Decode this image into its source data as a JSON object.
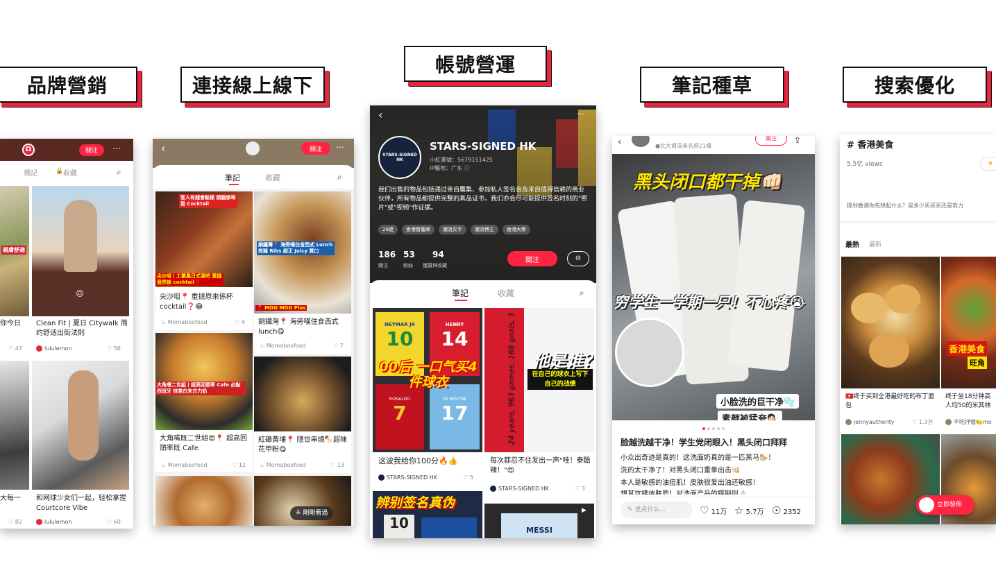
{
  "section_labels": [
    "品牌營銷",
    "連接線上線下",
    "帳號營運",
    "筆記種草",
    "搜索優化"
  ],
  "phone1": {
    "follow": "關注",
    "tabs": [
      "標記",
      "收藏"
    ],
    "cards": [
      {
        "title": "你今日",
        "likes": "47"
      },
      {
        "title": "Clean Fit | 夏日 Citywalk 简约舒适出街法則",
        "author": "lululemon",
        "likes": "56"
      },
      {
        "title": "大每一",
        "likes": "82"
      },
      {
        "title": "和网球少女们一起，轻松拿捏 Courtcore Vibe",
        "author": "lululemon",
        "likes": "60"
      }
    ],
    "overlay": "親膚舒適"
  },
  "phone2": {
    "follow": "關注",
    "tabs": [
      "筆記",
      "收藏"
    ],
    "cards": [
      {
        "title": "尖沙咀📍 重撻原來係杯 cocktail❓😂",
        "author": "Momaboofood",
        "likes": "4",
        "overlay_top": "客人有錢會點樣 頭腦係咪是 Cocktail",
        "overlay_bottom": "尖沙咀丨工業風日式酒吧 重撻竟然係 cocktail❓"
      },
      {
        "title": "銅鑼灣📍 海旁嘆住食西式 lunch😋",
        "author": "Momaboofood",
        "likes": "7",
        "overlay_top": "銅鑼灣📍 海旁嘆住食西式 Lunch 煎豬 Ribs 超正 Juicy 質口",
        "overlay_bottom": "📍 MOO MOO Plus"
      },
      {
        "title": "大角嘴既二世組😍📍 超高回頭率既 Cafe",
        "author": "Momaboofood",
        "likes": "12",
        "overlay_top": "大角嘴二世組丨超高回頭率 Cafe 必點西班牙 抹茶白朱古力奶"
      },
      {
        "title": "紅磡黃埔📍 隱世串燒🍢超味花甲粉😋",
        "author": "Momaboofood",
        "likes": "13"
      }
    ],
    "more_button": "剛剛看過"
  },
  "phone3": {
    "account_name": "STARS-SIGNED HK",
    "account_id": "小紅書號：5679151425",
    "ip": "IP屬地：广东 ⓘ",
    "bio": "我们出售的物品包括通过亲自鷹集、参加私人签名会及来自值得信赖的商业伙伴，所有物品都提供完整的真品证书，我们亦会尽可能提供签名时刻的\"照片\"或\"视频\"作证据。",
    "tags": [
      "29歲",
      "香港營養師",
      "潮流买手",
      "潮流博主",
      "香港大學"
    ],
    "stats": [
      {
        "value": "186",
        "label": "關注"
      },
      {
        "value": "53",
        "label": "粉絲"
      },
      {
        "value": "94",
        "label": "獲贊與收藏"
      }
    ],
    "follow": "關注",
    "tabs": [
      "筆記",
      "收藏"
    ],
    "cards": [
      {
        "title": "这波我给你100分🔥👍",
        "author": "STARS-SIGNED HK",
        "likes": "5",
        "overlay": "00后 一口气买4件球衣"
      },
      {
        "title": "每次都忍不住发出一声\"哇！泰酷辣！\"😍",
        "author": "STARS-SIGNED HK",
        "likes": "3",
        "overlay": "他是谁？",
        "overlay2": "在自己的球衣上写下 自己的战绩",
        "handwritten": "24 years, 963 games, 168 goals, 34 trophies"
      },
      {
        "overlay": "辨别签名真伪"
      }
    ],
    "shirt_labels": [
      "NEYMAR JR",
      "HENRY",
      "RONALDO",
      "DE BRUYNE",
      "MESSI"
    ],
    "shirt_numbers": [
      "10",
      "14",
      "7",
      "17",
      "10"
    ]
  },
  "phone4": {
    "top_author": "●北大資深未名府21樓",
    "follow": "關注",
    "overlay_top": "黑头闭口都干掉👊🏻",
    "overlay_mid": "穷学生一学期一只！不心疼😭",
    "overlay_b1": "小脸洗的巨干净🫧",
    "overlay_b2": "素颜被猛夸💁🏻",
    "title": "脸越洗越干净！学生党闭眼入！黑头闭口拜拜",
    "body": [
      "小众出奇迹是真的！这洗面奶真的是一匹黑马🐎！",
      "洗的太干净了！对黑头闭口重拳出击👊🏻",
      "本人是敏感的油痘肌！皮肤很爱出油还敏感！",
      "想其坑拂纳肤质！对洗面产品的摆期则👌🏻"
    ],
    "comment_placeholder": "说点什么...",
    "likes": "11万",
    "stars": "5.7万",
    "comments": "2352"
  },
  "phone5": {
    "hashtag": "# 香港美食",
    "views": "5.5亿 views",
    "prompt": "提到香港你先想起什么？是多少买买买还是努力",
    "tabs": [
      "最熱",
      "最新"
    ],
    "cards": [
      {
        "title": "🇭🇰终于买到全港最好吃的布丁面包",
        "author": "jennyauthority",
        "likes": "1.3万"
      },
      {
        "title": "终于坐18分钟高人均50的米其林",
        "author": "不吃抒憶🍋mo"
      }
    ],
    "overlay": "香港美食",
    "overlay2": "旺角",
    "publish_button": "立即發佈"
  },
  "colors": {
    "accent": "#e8243f",
    "xhs_red": "#ff2442"
  },
  "icons": [
    "lululemon-logo-icon",
    "search-icon",
    "heart-icon",
    "star-icon",
    "comment-icon",
    "back-icon",
    "more-icon",
    "share-icon",
    "pen-icon",
    "lock-icon",
    "chevron-down-icon",
    "play-icon"
  ]
}
